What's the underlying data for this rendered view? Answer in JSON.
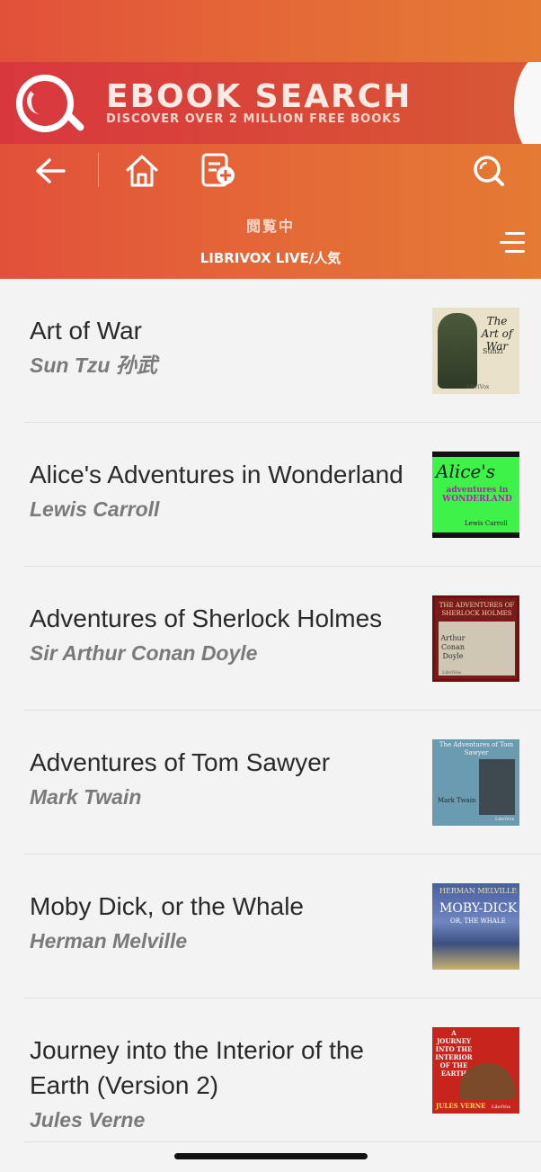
{
  "banner": {
    "title": "EBOOK SEARCH",
    "subtitle": "DISCOVER OVER 2 MILLION FREE BOOKS"
  },
  "toolbar": {
    "back_icon": "back-arrow-icon",
    "home_icon": "home-icon",
    "add_icon": "add-document-icon",
    "search_icon": "search-icon"
  },
  "header": {
    "status": "閲覧中",
    "category": "LIBRIVOX LIVE/人気",
    "menu_icon": "menu-icon"
  },
  "books": [
    {
      "title": "Art of War",
      "author": "Sun Tzu 孙武",
      "cover_text": "The Art of War",
      "cover_sub": "Sunzi",
      "cover_tag": "LibriVox"
    },
    {
      "title": "Alice's Adventures in Wonderland",
      "author": "Lewis Carroll",
      "cover_text": "Alice's",
      "cover_sub": "adventures in WONDERLAND",
      "cover_tag": "Lewis Carroll"
    },
    {
      "title": "Adventures of Sherlock Holmes",
      "author": "Sir Arthur Conan Doyle",
      "cover_text": "THE ADVENTURES OF SHERLOCK HOLMES",
      "cover_sub": "Arthur Conan Doyle",
      "cover_tag": "LibriVox"
    },
    {
      "title": "Adventures of Tom Sawyer",
      "author": "Mark Twain",
      "cover_text": "The Adventures of Tom Sawyer",
      "cover_sub": "Mark Twain",
      "cover_tag": "LibriVox"
    },
    {
      "title": "Moby Dick, or the Whale",
      "author": "Herman Melville",
      "cover_text": "HERMAN MELVILLE",
      "cover_sub": "MOBY-DICK",
      "cover_tag": "OR, THE WHALE"
    },
    {
      "title": "Journey into the Interior of the Earth (Version 2)",
      "author": "Jules Verne",
      "cover_text": "A JOURNEY INTO THE INTERIOR OF THE EARTH",
      "cover_sub": "JULES VERNE",
      "cover_tag": "LibriVox"
    }
  ],
  "colors": {
    "header_start": "#e2503a",
    "header_end": "#e47a34",
    "banner": "#d8373f",
    "background": "#f3f3f3"
  }
}
